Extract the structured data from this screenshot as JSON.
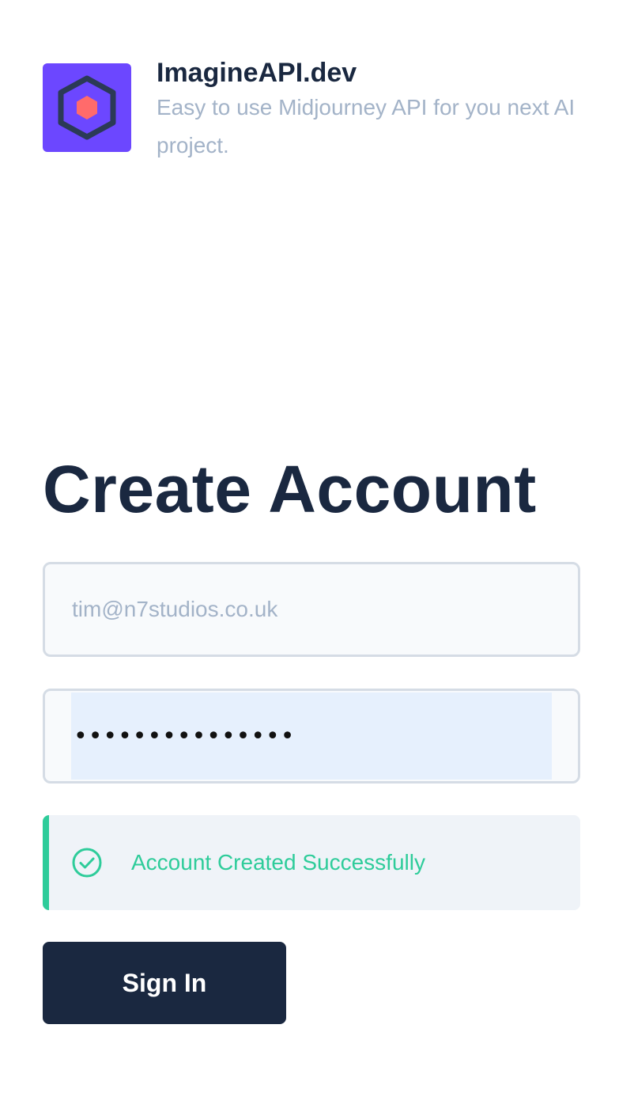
{
  "brand": {
    "name": "ImagineAPI.dev",
    "tagline": "Easy to use Midjourney API for you next AI project.",
    "logo_color": "#6c47ff",
    "logo_icon": "hexagon-icon"
  },
  "form": {
    "title": "Create Account",
    "email_placeholder": "tim@n7studios.co.uk",
    "email_value": "",
    "password_display": "•••••••••••••••",
    "submit_label": "Sign In"
  },
  "alert": {
    "type": "success",
    "icon": "check-circle-icon",
    "message": "Account Created Successfully",
    "color": "#2ecc9a"
  },
  "colors": {
    "primary_text": "#1a2840",
    "muted_text": "#a3b3c8",
    "button_bg": "#1a2840"
  }
}
